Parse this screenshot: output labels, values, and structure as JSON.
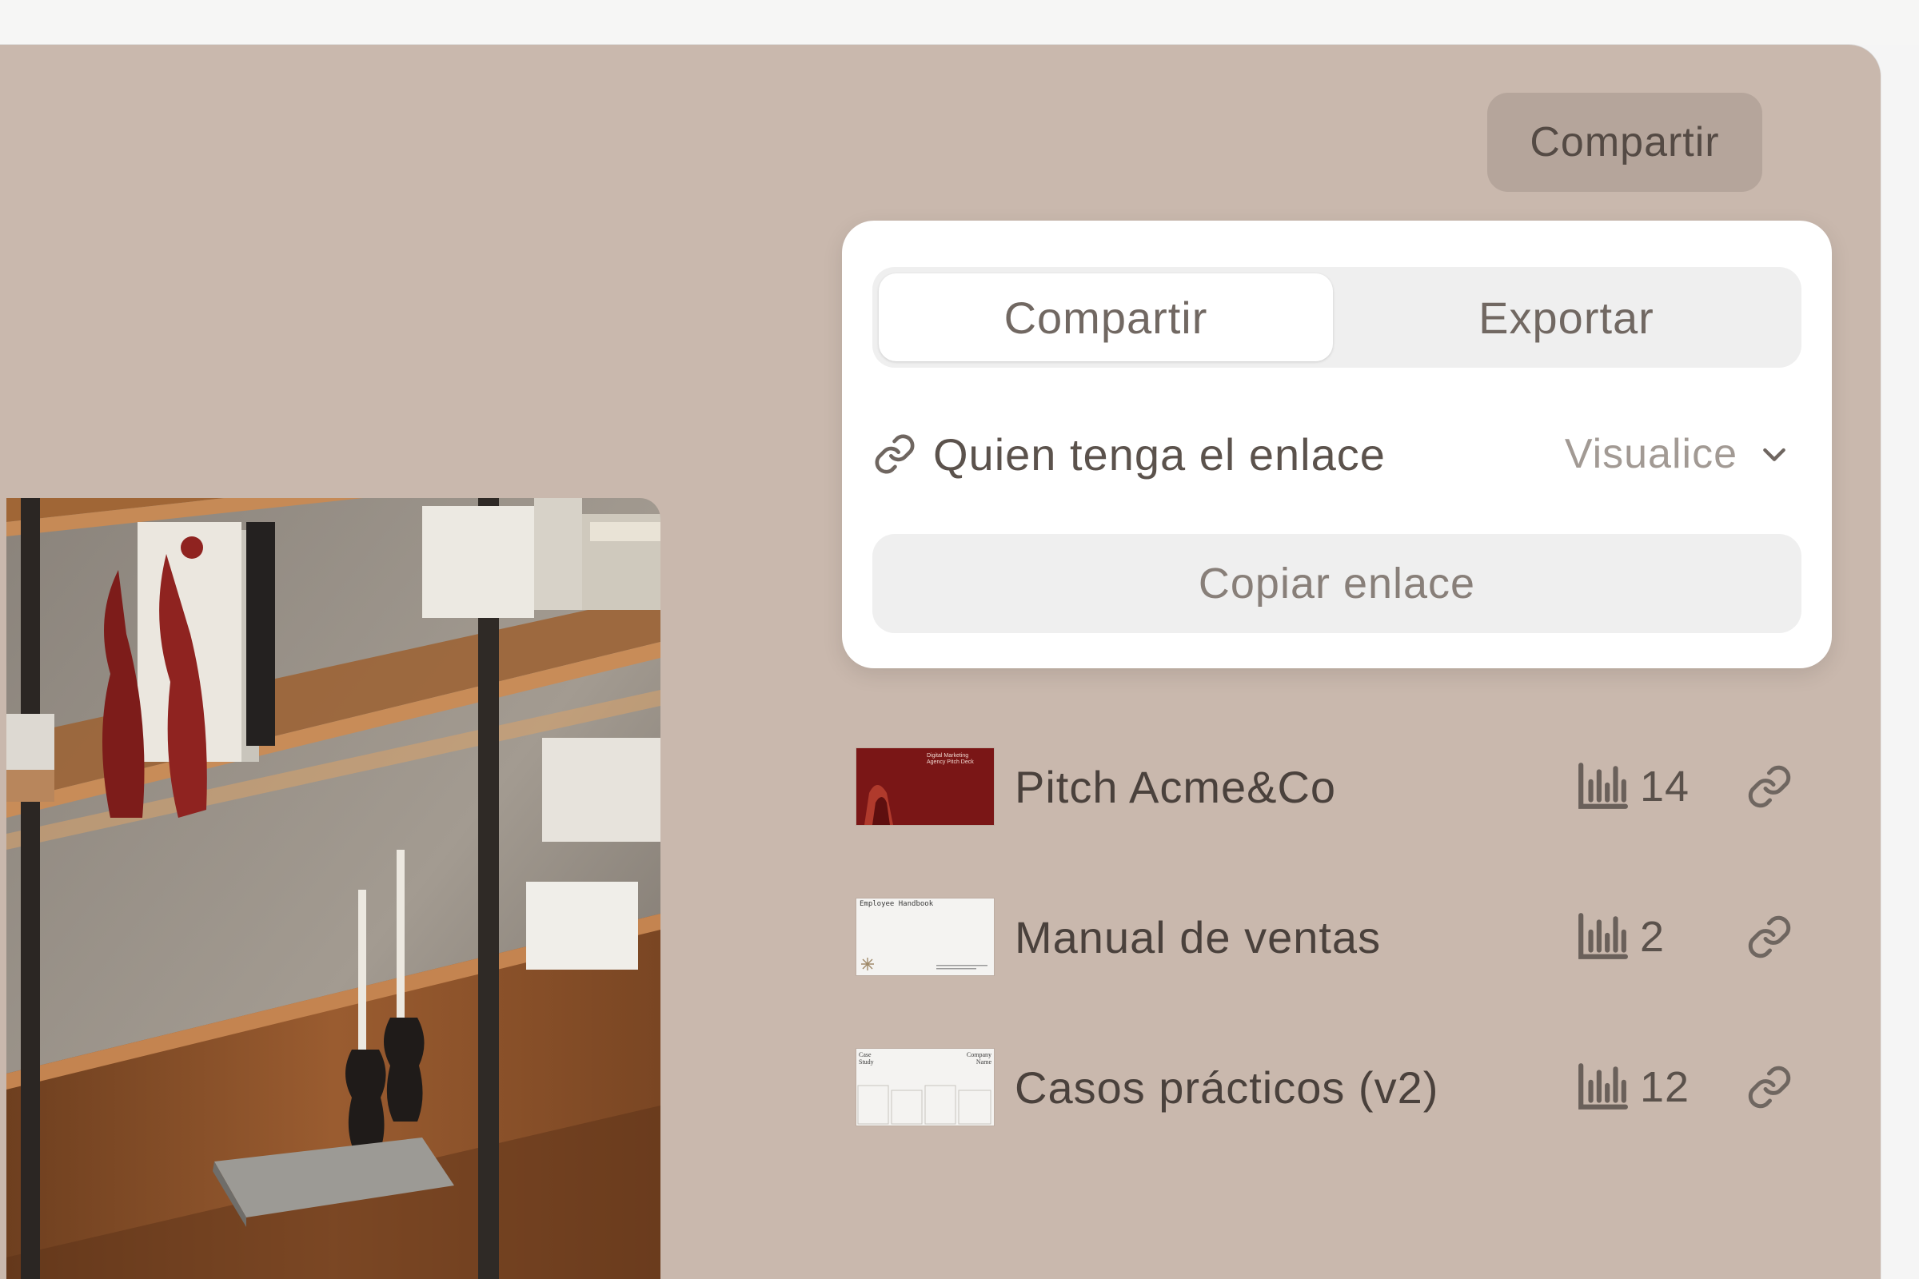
{
  "header": {
    "share_button": "Compartir"
  },
  "share_panel": {
    "tabs": [
      {
        "label": "Compartir",
        "active": true
      },
      {
        "label": "Exportar",
        "active": false
      }
    ],
    "access": {
      "icon": "link-icon",
      "label": "Quien tenga el enlace",
      "permission": "Visualice",
      "dropdown_icon": "chevron-down-icon"
    },
    "copy_link": "Copiar enlace"
  },
  "documents": [
    {
      "name": "Pitch Acme&Co",
      "views": "14",
      "thumbnail_text": "Digital Marketing Agency Pitch Deck",
      "thumbnail_color": "#7a1616"
    },
    {
      "name": "Manual de ventas",
      "views": "2",
      "thumbnail_text": "Employee Handbook",
      "thumbnail_color": "#f4f3f1"
    },
    {
      "name": "Casos prácticos (v2)",
      "views": "12",
      "thumbnail_text": "Case Study",
      "thumbnail_text_2": "Company Name",
      "thumbnail_color": "#f4f3f1"
    }
  ],
  "colors": {
    "frame_background": "#c9b8ad",
    "accent_button": "#b5a59b",
    "panel_background": "#ffffff"
  }
}
